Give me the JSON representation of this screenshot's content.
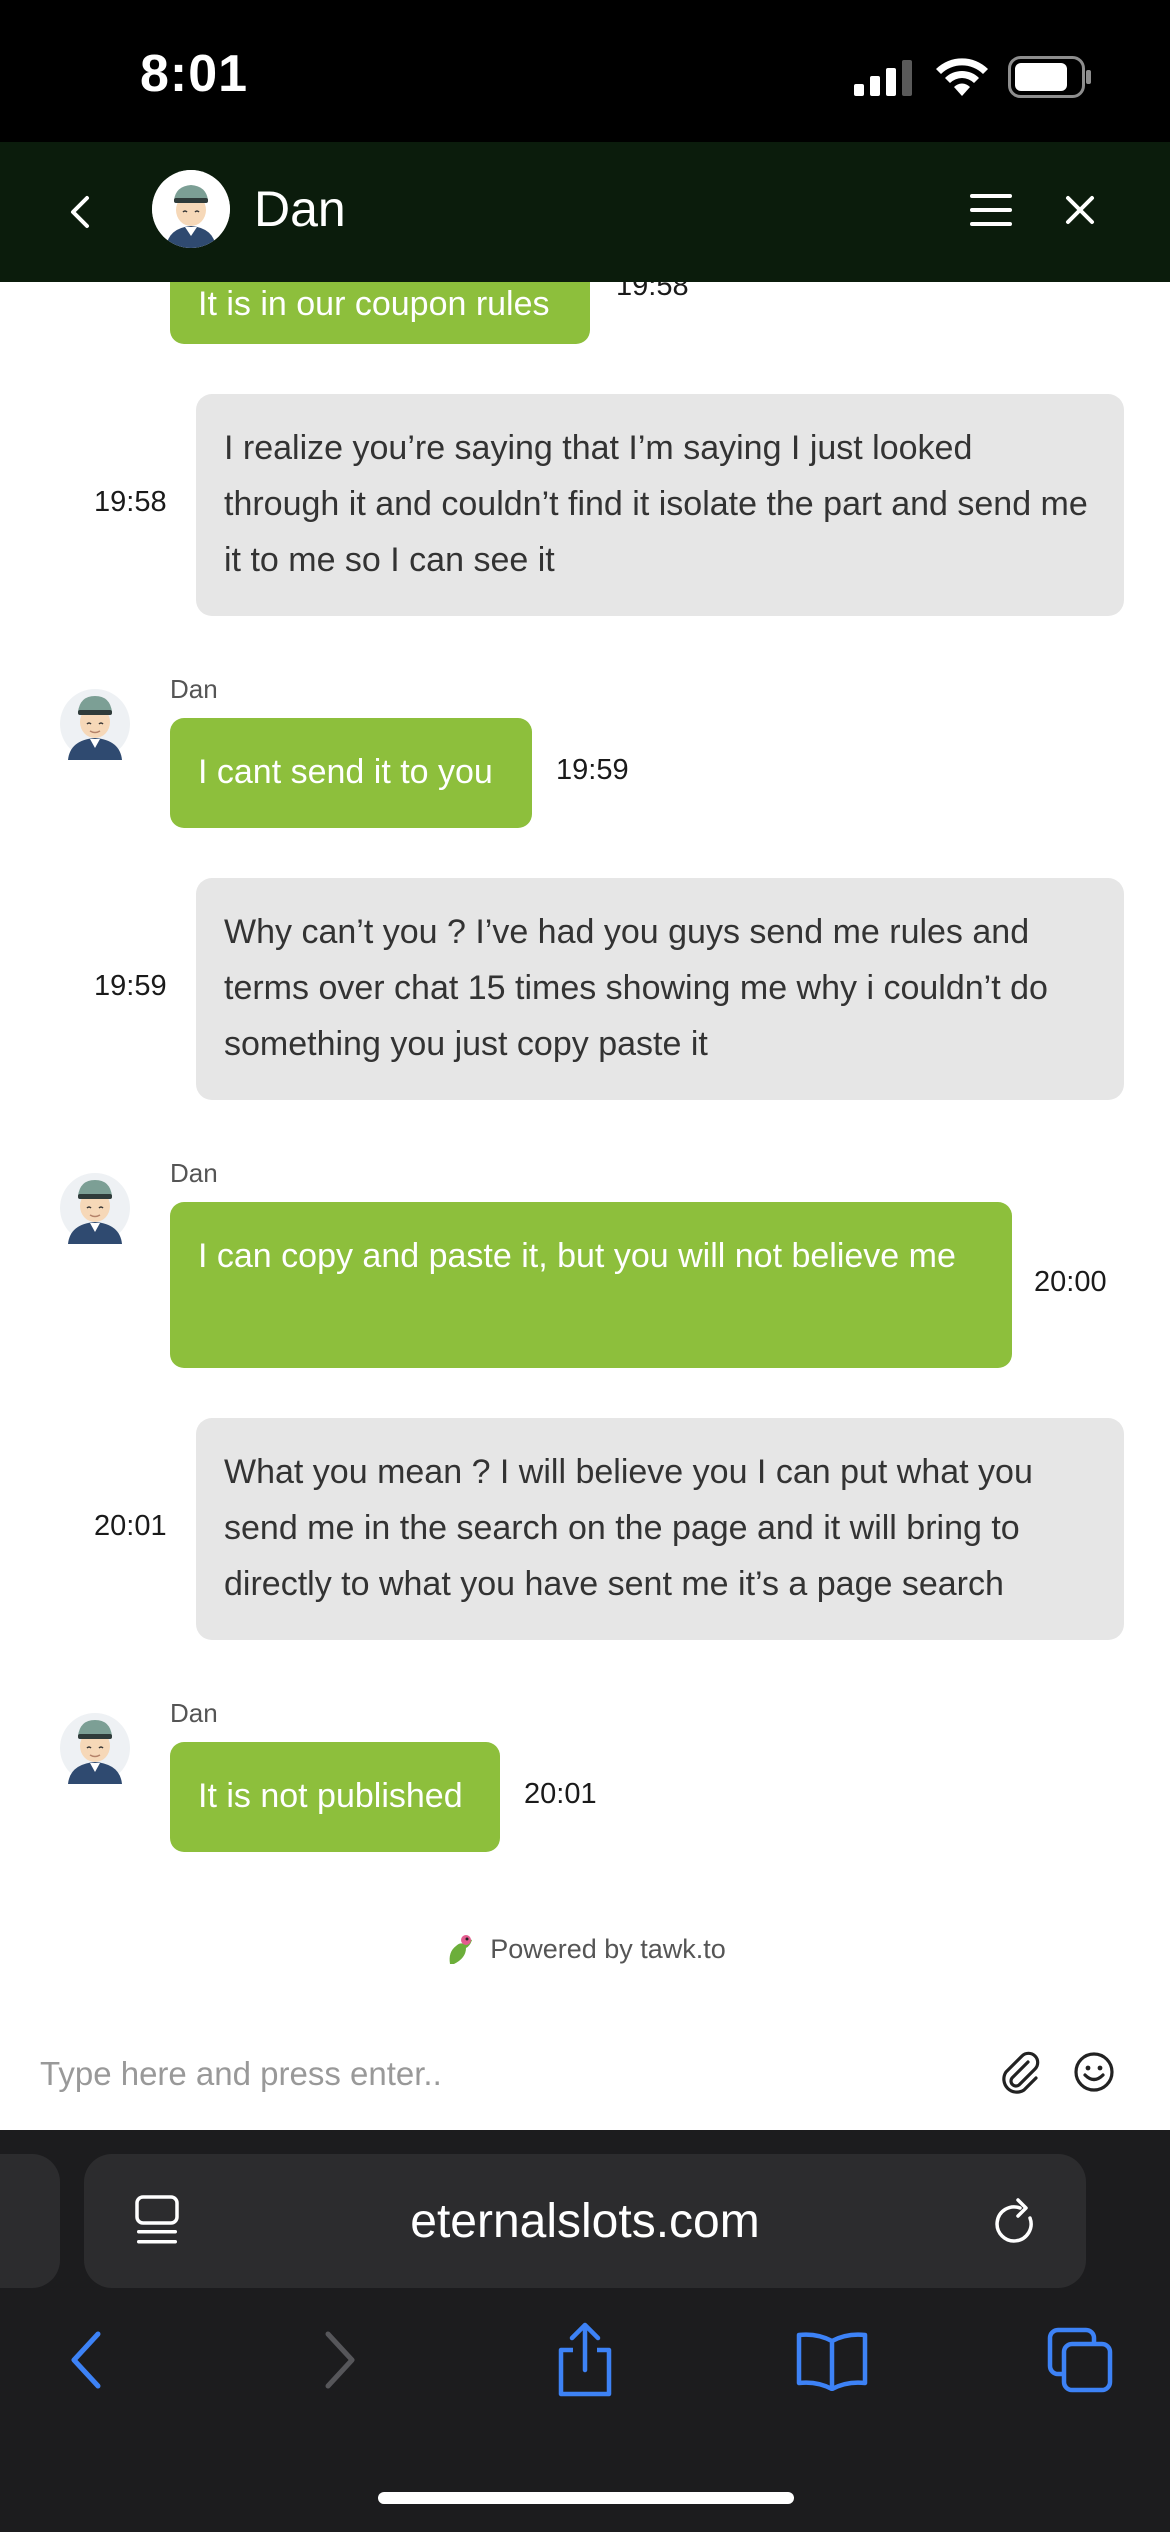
{
  "status_bar": {
    "time": "8:01"
  },
  "header": {
    "agent_name": "Dan"
  },
  "messages": {
    "m0": {
      "text": "It is in our coupon rules",
      "time": "19:58"
    },
    "m1": {
      "text": "I realize you’re saying that I’m saying I just looked through it and couldn’t find it isolate the part and send me it to me so I can see it",
      "time": "19:58"
    },
    "m2": {
      "sender": "Dan",
      "text": "I cant send it to you",
      "time": "19:59"
    },
    "m3": {
      "text": "Why can’t you ? I’ve had you guys send me rules and terms over chat 15 times showing me why i couldn’t do something you just copy paste it",
      "time": "19:59"
    },
    "m4": {
      "sender": "Dan",
      "text": "I can copy and paste it, but you will not believe me",
      "time": "20:00"
    },
    "m5": {
      "text": "What you mean ? I will believe you I can put what you send me in the search on the page and it will bring to directly to what you have sent me it’s a page search",
      "time": "20:01"
    },
    "m6": {
      "sender": "Dan",
      "text": "It is not published",
      "time": "20:01"
    }
  },
  "powered_by": "Powered by tawk.to",
  "composer": {
    "placeholder": "Type here and press enter.."
  },
  "browser": {
    "url": "eternalslots.com"
  },
  "colors": {
    "header_bg": "#0b1c0c",
    "agent_bubble": "#8dbf3c",
    "visitor_bubble": "#e6e6e6",
    "safari_accent": "#3d82f6"
  },
  "icons": [
    "back-chevron-icon",
    "menu-icon",
    "close-icon",
    "paperclip-icon",
    "emoji-icon",
    "reader-icon",
    "reload-icon",
    "back-icon",
    "forward-icon",
    "share-icon",
    "bookmarks-icon",
    "tabs-icon"
  ]
}
